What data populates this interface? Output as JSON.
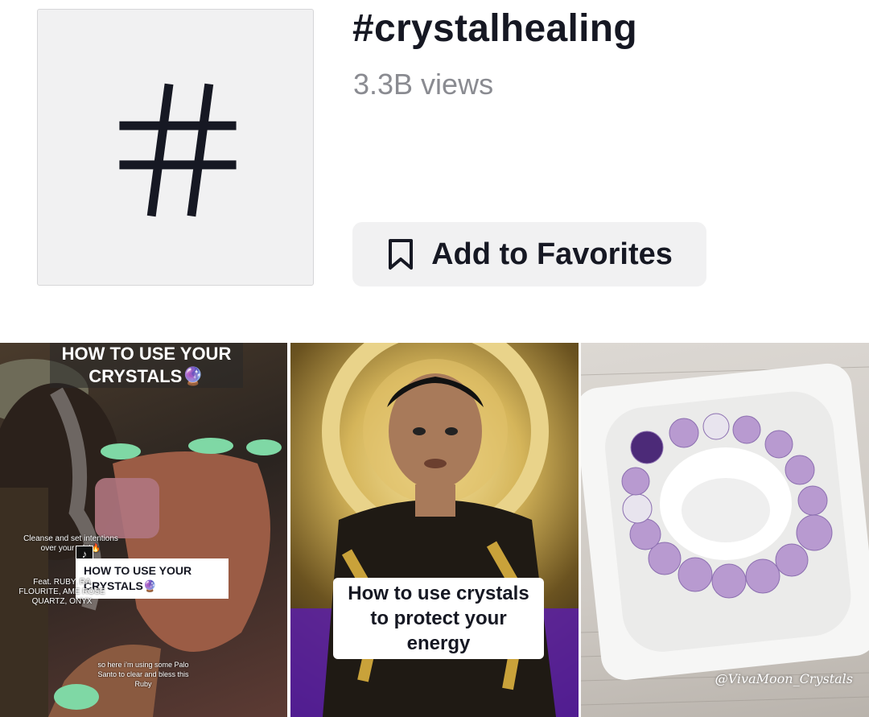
{
  "header": {
    "icon": "hashtag-icon",
    "title": "#crystalhealing",
    "views": "3.3B views",
    "favorite_label": "Add to Favorites",
    "favorite_icon": "bookmark-icon"
  },
  "videos": [
    {
      "caption_top": "HOW TO USE YOUR CRYSTALS🔮",
      "caption_box": "HOW TO USE YOUR CRYSTALS🔮",
      "note1": "Cleanse and set intentions over your c   ls!🔥",
      "note2": "Feat. RUBY, RA   FLOURITE, AME   ROSE QUARTZ,   ONYX",
      "note3": "so here i’m using some Palo Santo to clear and bless this Ruby"
    },
    {
      "caption": "How to use crystals to protect your energy"
    },
    {
      "watermark": "@VivaMoon_Crystals"
    }
  ],
  "colors": {
    "text": "#161823",
    "muted": "#8a8b91",
    "tile": "#f1f1f2"
  }
}
